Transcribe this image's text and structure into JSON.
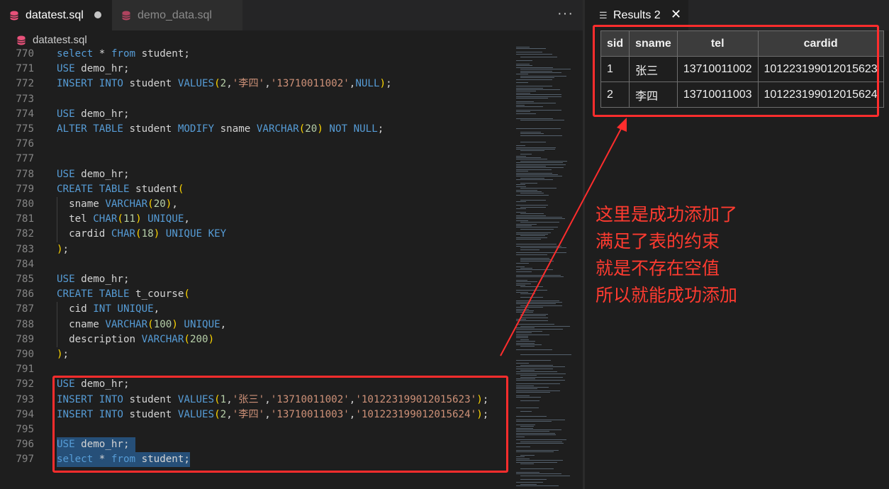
{
  "editor": {
    "tabs": [
      {
        "label": "datatest.sql",
        "modified": true
      },
      {
        "label": "demo_data.sql",
        "modified": false
      }
    ],
    "more_label": "···",
    "breadcrumb": "datatest.sql",
    "lines": [
      {
        "num": "770",
        "tokens": [
          [
            "k",
            "select"
          ],
          [
            "t",
            " * "
          ],
          [
            "k",
            "from"
          ],
          [
            "t",
            " student;"
          ]
        ]
      },
      {
        "num": "771",
        "tokens": [
          [
            "k",
            "USE"
          ],
          [
            "t",
            " demo_hr;"
          ]
        ]
      },
      {
        "num": "772",
        "tokens": [
          [
            "k",
            "INSERT INTO"
          ],
          [
            "t",
            " student "
          ],
          [
            "k",
            "VALUES"
          ],
          [
            "p",
            "("
          ],
          [
            "n",
            "2"
          ],
          [
            "t",
            ","
          ],
          [
            "s",
            "'李四'"
          ],
          [
            "t",
            ","
          ],
          [
            "s",
            "'13710011002'"
          ],
          [
            "t",
            ","
          ],
          [
            "k",
            "NULL"
          ],
          [
            "p",
            ")"
          ],
          [
            "t",
            ";"
          ]
        ]
      },
      {
        "num": "773",
        "tokens": []
      },
      {
        "num": "774",
        "tokens": [
          [
            "k",
            "USE"
          ],
          [
            "t",
            " demo_hr;"
          ]
        ]
      },
      {
        "num": "775",
        "tokens": [
          [
            "k",
            "ALTER TABLE"
          ],
          [
            "t",
            " student "
          ],
          [
            "k",
            "MODIFY"
          ],
          [
            "t",
            " sname "
          ],
          [
            "k",
            "VARCHAR"
          ],
          [
            "p",
            "("
          ],
          [
            "n",
            "20"
          ],
          [
            "p",
            ")"
          ],
          [
            "t",
            " "
          ],
          [
            "k",
            "NOT NULL"
          ],
          [
            "t",
            ";"
          ]
        ]
      },
      {
        "num": "776",
        "tokens": []
      },
      {
        "num": "777",
        "tokens": []
      },
      {
        "num": "778",
        "tokens": [
          [
            "k",
            "USE"
          ],
          [
            "t",
            " demo_hr;"
          ]
        ]
      },
      {
        "num": "779",
        "tokens": [
          [
            "k",
            "CREATE TABLE"
          ],
          [
            "t",
            " student"
          ],
          [
            "p",
            "("
          ]
        ]
      },
      {
        "num": "780",
        "tokens": [
          [
            "t",
            "  sname "
          ],
          [
            "k",
            "VARCHAR"
          ],
          [
            "p",
            "("
          ],
          [
            "n",
            "20"
          ],
          [
            "p",
            ")"
          ],
          [
            "t",
            ","
          ]
        ]
      },
      {
        "num": "781",
        "tokens": [
          [
            "t",
            "  tel "
          ],
          [
            "k",
            "CHAR"
          ],
          [
            "p",
            "("
          ],
          [
            "n",
            "11"
          ],
          [
            "p",
            ")"
          ],
          [
            "t",
            " "
          ],
          [
            "k",
            "UNIQUE"
          ],
          [
            "t",
            ","
          ]
        ]
      },
      {
        "num": "782",
        "tokens": [
          [
            "t",
            "  cardid "
          ],
          [
            "k",
            "CHAR"
          ],
          [
            "p",
            "("
          ],
          [
            "n",
            "18"
          ],
          [
            "p",
            ")"
          ],
          [
            "t",
            " "
          ],
          [
            "k",
            "UNIQUE KEY"
          ]
        ]
      },
      {
        "num": "783",
        "tokens": [
          [
            "p",
            ")"
          ],
          [
            "t",
            ";"
          ]
        ]
      },
      {
        "num": "784",
        "tokens": []
      },
      {
        "num": "785",
        "tokens": [
          [
            "k",
            "USE"
          ],
          [
            "t",
            " demo_hr;"
          ]
        ]
      },
      {
        "num": "786",
        "tokens": [
          [
            "k",
            "CREATE TABLE"
          ],
          [
            "t",
            " t_course"
          ],
          [
            "p",
            "("
          ]
        ]
      },
      {
        "num": "787",
        "tokens": [
          [
            "t",
            "  cid "
          ],
          [
            "k",
            "INT UNIQUE"
          ],
          [
            "t",
            ","
          ]
        ]
      },
      {
        "num": "788",
        "tokens": [
          [
            "t",
            "  cname "
          ],
          [
            "k",
            "VARCHAR"
          ],
          [
            "p",
            "("
          ],
          [
            "n",
            "100"
          ],
          [
            "p",
            ")"
          ],
          [
            "t",
            " "
          ],
          [
            "k",
            "UNIQUE"
          ],
          [
            "t",
            ","
          ]
        ]
      },
      {
        "num": "789",
        "tokens": [
          [
            "t",
            "  description "
          ],
          [
            "k",
            "VARCHAR"
          ],
          [
            "p",
            "("
          ],
          [
            "n",
            "200"
          ],
          [
            "p",
            ")"
          ]
        ]
      },
      {
        "num": "790",
        "tokens": [
          [
            "p",
            ")"
          ],
          [
            "t",
            ";"
          ]
        ]
      },
      {
        "num": "791",
        "tokens": []
      },
      {
        "num": "792",
        "tokens": [
          [
            "k",
            "USE"
          ],
          [
            "t",
            " demo_hr;"
          ]
        ]
      },
      {
        "num": "793",
        "tokens": [
          [
            "k",
            "INSERT INTO"
          ],
          [
            "t",
            " student "
          ],
          [
            "k",
            "VALUES"
          ],
          [
            "p",
            "("
          ],
          [
            "n",
            "1"
          ],
          [
            "t",
            ","
          ],
          [
            "s",
            "'张三'"
          ],
          [
            "t",
            ","
          ],
          [
            "s",
            "'13710011002'"
          ],
          [
            "t",
            ","
          ],
          [
            "s",
            "'101223199012015623'"
          ],
          [
            "p",
            ")"
          ],
          [
            "t",
            ";"
          ]
        ]
      },
      {
        "num": "794",
        "tokens": [
          [
            "k",
            "INSERT INTO"
          ],
          [
            "t",
            " student "
          ],
          [
            "k",
            "VALUES"
          ],
          [
            "p",
            "("
          ],
          [
            "n",
            "2"
          ],
          [
            "t",
            ","
          ],
          [
            "s",
            "'李四'"
          ],
          [
            "t",
            ","
          ],
          [
            "s",
            "'13710011003'"
          ],
          [
            "t",
            ","
          ],
          [
            "s",
            "'101223199012015624'"
          ],
          [
            "p",
            ")"
          ],
          [
            "t",
            ";"
          ]
        ]
      },
      {
        "num": "795",
        "tokens": []
      },
      {
        "num": "796",
        "tokens": [
          [
            "k",
            "USE"
          ],
          [
            "t",
            " demo_hr;"
          ]
        ],
        "selected": true
      },
      {
        "num": "797",
        "tokens": [
          [
            "k",
            "select"
          ],
          [
            "t",
            " * "
          ],
          [
            "k",
            "from"
          ],
          [
            "t",
            " student;"
          ]
        ],
        "selected": true
      }
    ]
  },
  "results": {
    "tab_label": "Results 2",
    "close_label": "✕",
    "columns": [
      "sid",
      "sname",
      "tel",
      "cardid"
    ],
    "rows": [
      [
        "1",
        "张三",
        "13710011002",
        "101223199012015623"
      ],
      [
        "2",
        "李四",
        "13710011003",
        "101223199012015624"
      ]
    ]
  },
  "annotation": {
    "lines": [
      "这里是成功添加了",
      "满足了表的约束",
      "就是不存在空值",
      "所以就能成功添加"
    ],
    "color": "#ff3b30"
  },
  "colors": {
    "keyword": "#569cd6",
    "string": "#ce9178",
    "number": "#b5cea8",
    "bracket": "#ffd700",
    "highlight": "#ff2d2d"
  }
}
